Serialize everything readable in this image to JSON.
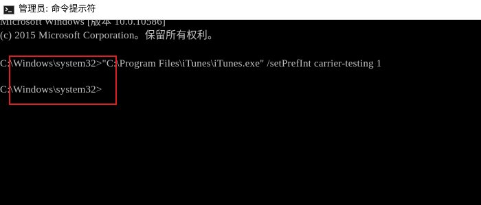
{
  "window": {
    "title": "管理员: 命令提示符",
    "icon": "cmd-icon"
  },
  "console": {
    "lines": [
      "Microsoft Windows [版本 10.0.10586]",
      "(c) 2015 Microsoft Corporation。保留所有权利。",
      "",
      "C:\\Windows\\system32>\"C:\\Program Files\\iTunes\\iTunes.exe\" /setPrefInt carrier-testing 1",
      "",
      "C:\\Windows\\system32>"
    ],
    "text_color": "#c0c0c0",
    "background_color": "#000000"
  },
  "annotation": {
    "color": "#e02020"
  }
}
